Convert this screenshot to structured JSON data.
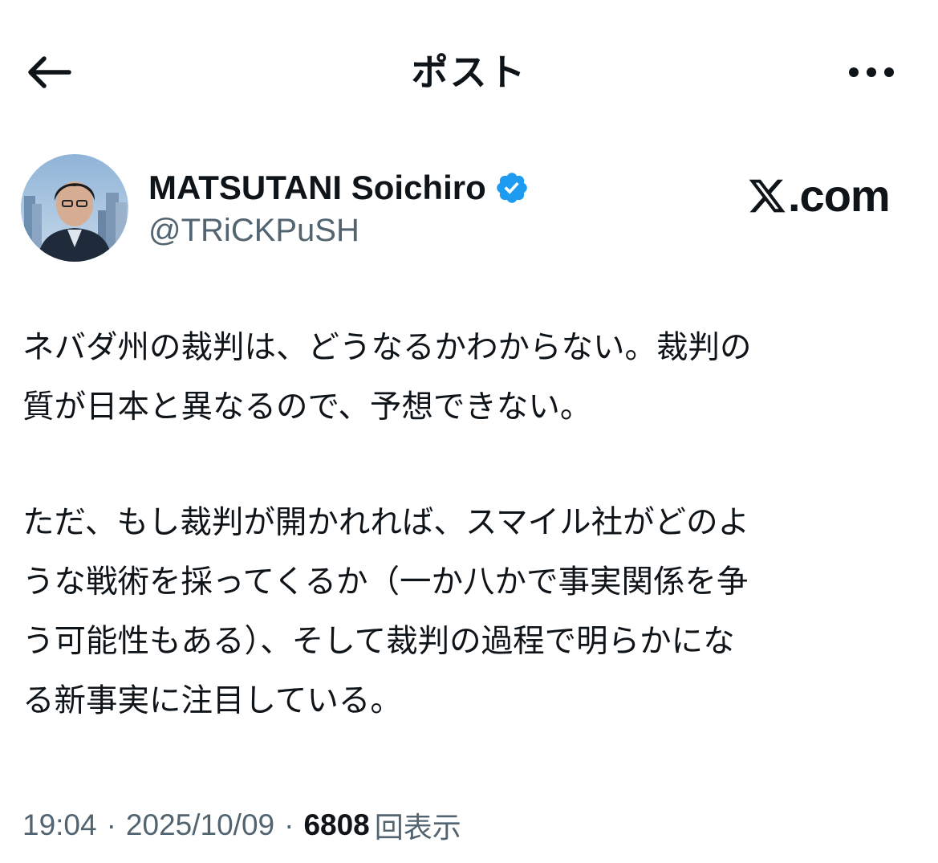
{
  "header": {
    "title": "ポスト",
    "back_icon": "arrow-left-icon",
    "more_icon": "more-horizontal-icon"
  },
  "author": {
    "display_name": "MATSUTANI Soichiro",
    "handle": "@TRiCKPuSH",
    "verified": true,
    "badge_color": "#1d9bf0"
  },
  "watermark": {
    "text": ".com",
    "logo": "x-logo"
  },
  "post": {
    "lines": [
      "ネバダ州の裁判は、どうなるかわからない。裁判の",
      "質が日本と異なるので、予想できない。",
      "ただ、もし裁判が開かれれば、スマイル社がどのよ",
      "うな戦術を採ってくるか（一か八かで事実関係を争",
      "う可能性もある）、そして裁判の過程で明らかにな",
      "る新事実に注目している。"
    ]
  },
  "meta": {
    "time": "19:04",
    "separator": "·",
    "date": "2025/10/09",
    "views_count": "6808",
    "views_label": "回表示"
  },
  "colors": {
    "text": "#0f1419",
    "secondary": "#536471",
    "accent": "#1d9bf0"
  }
}
